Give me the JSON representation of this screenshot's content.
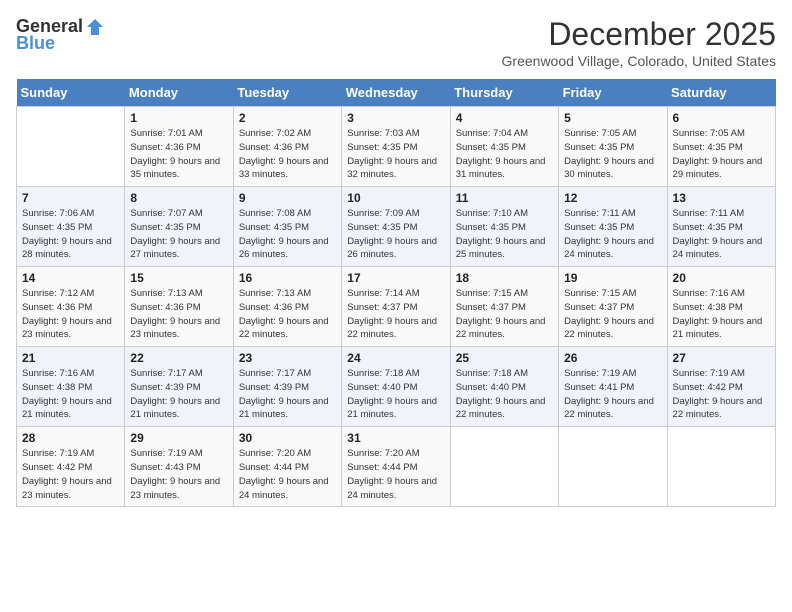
{
  "header": {
    "logo_general": "General",
    "logo_blue": "Blue",
    "month_title": "December 2025",
    "subtitle": "Greenwood Village, Colorado, United States"
  },
  "weekdays": [
    "Sunday",
    "Monday",
    "Tuesday",
    "Wednesday",
    "Thursday",
    "Friday",
    "Saturday"
  ],
  "weeks": [
    [
      {
        "day": null
      },
      {
        "day": "1",
        "sunrise": "7:01 AM",
        "sunset": "4:36 PM",
        "daylight": "9 hours and 35 minutes."
      },
      {
        "day": "2",
        "sunrise": "7:02 AM",
        "sunset": "4:36 PM",
        "daylight": "9 hours and 33 minutes."
      },
      {
        "day": "3",
        "sunrise": "7:03 AM",
        "sunset": "4:35 PM",
        "daylight": "9 hours and 32 minutes."
      },
      {
        "day": "4",
        "sunrise": "7:04 AM",
        "sunset": "4:35 PM",
        "daylight": "9 hours and 31 minutes."
      },
      {
        "day": "5",
        "sunrise": "7:05 AM",
        "sunset": "4:35 PM",
        "daylight": "9 hours and 30 minutes."
      },
      {
        "day": "6",
        "sunrise": "7:05 AM",
        "sunset": "4:35 PM",
        "daylight": "9 hours and 29 minutes."
      }
    ],
    [
      {
        "day": "7",
        "sunrise": "7:06 AM",
        "sunset": "4:35 PM",
        "daylight": "9 hours and 28 minutes."
      },
      {
        "day": "8",
        "sunrise": "7:07 AM",
        "sunset": "4:35 PM",
        "daylight": "9 hours and 27 minutes."
      },
      {
        "day": "9",
        "sunrise": "7:08 AM",
        "sunset": "4:35 PM",
        "daylight": "9 hours and 26 minutes."
      },
      {
        "day": "10",
        "sunrise": "7:09 AM",
        "sunset": "4:35 PM",
        "daylight": "9 hours and 26 minutes."
      },
      {
        "day": "11",
        "sunrise": "7:10 AM",
        "sunset": "4:35 PM",
        "daylight": "9 hours and 25 minutes."
      },
      {
        "day": "12",
        "sunrise": "7:11 AM",
        "sunset": "4:35 PM",
        "daylight": "9 hours and 24 minutes."
      },
      {
        "day": "13",
        "sunrise": "7:11 AM",
        "sunset": "4:35 PM",
        "daylight": "9 hours and 24 minutes."
      }
    ],
    [
      {
        "day": "14",
        "sunrise": "7:12 AM",
        "sunset": "4:36 PM",
        "daylight": "9 hours and 23 minutes."
      },
      {
        "day": "15",
        "sunrise": "7:13 AM",
        "sunset": "4:36 PM",
        "daylight": "9 hours and 23 minutes."
      },
      {
        "day": "16",
        "sunrise": "7:13 AM",
        "sunset": "4:36 PM",
        "daylight": "9 hours and 22 minutes."
      },
      {
        "day": "17",
        "sunrise": "7:14 AM",
        "sunset": "4:37 PM",
        "daylight": "9 hours and 22 minutes."
      },
      {
        "day": "18",
        "sunrise": "7:15 AM",
        "sunset": "4:37 PM",
        "daylight": "9 hours and 22 minutes."
      },
      {
        "day": "19",
        "sunrise": "7:15 AM",
        "sunset": "4:37 PM",
        "daylight": "9 hours and 22 minutes."
      },
      {
        "day": "20",
        "sunrise": "7:16 AM",
        "sunset": "4:38 PM",
        "daylight": "9 hours and 21 minutes."
      }
    ],
    [
      {
        "day": "21",
        "sunrise": "7:16 AM",
        "sunset": "4:38 PM",
        "daylight": "9 hours and 21 minutes."
      },
      {
        "day": "22",
        "sunrise": "7:17 AM",
        "sunset": "4:39 PM",
        "daylight": "9 hours and 21 minutes."
      },
      {
        "day": "23",
        "sunrise": "7:17 AM",
        "sunset": "4:39 PM",
        "daylight": "9 hours and 21 minutes."
      },
      {
        "day": "24",
        "sunrise": "7:18 AM",
        "sunset": "4:40 PM",
        "daylight": "9 hours and 21 minutes."
      },
      {
        "day": "25",
        "sunrise": "7:18 AM",
        "sunset": "4:40 PM",
        "daylight": "9 hours and 22 minutes."
      },
      {
        "day": "26",
        "sunrise": "7:19 AM",
        "sunset": "4:41 PM",
        "daylight": "9 hours and 22 minutes."
      },
      {
        "day": "27",
        "sunrise": "7:19 AM",
        "sunset": "4:42 PM",
        "daylight": "9 hours and 22 minutes."
      }
    ],
    [
      {
        "day": "28",
        "sunrise": "7:19 AM",
        "sunset": "4:42 PM",
        "daylight": "9 hours and 23 minutes."
      },
      {
        "day": "29",
        "sunrise": "7:19 AM",
        "sunset": "4:43 PM",
        "daylight": "9 hours and 23 minutes."
      },
      {
        "day": "30",
        "sunrise": "7:20 AM",
        "sunset": "4:44 PM",
        "daylight": "9 hours and 24 minutes."
      },
      {
        "day": "31",
        "sunrise": "7:20 AM",
        "sunset": "4:44 PM",
        "daylight": "9 hours and 24 minutes."
      },
      {
        "day": null
      },
      {
        "day": null
      },
      {
        "day": null
      }
    ]
  ]
}
